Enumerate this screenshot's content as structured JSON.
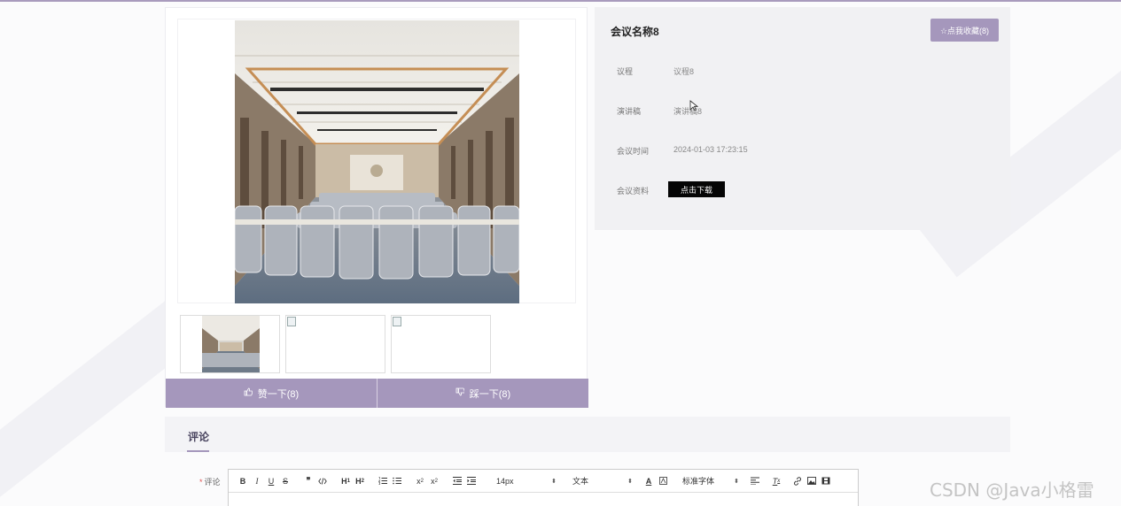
{
  "meeting": {
    "name": "会议名称8",
    "favorite_label": "☆点我收藏(8)",
    "details": [
      {
        "label": "议程",
        "value": "议程8"
      },
      {
        "label": "演讲稿",
        "value": "演讲稿8"
      },
      {
        "label": "会议时间",
        "value": "2024-01-03 17:23:15"
      },
      {
        "label": "会议资料",
        "value": ""
      }
    ],
    "download_label": "点击下载"
  },
  "vote": {
    "like_label": "赞一下(8)",
    "dislike_label": "踩一下(8)"
  },
  "comments": {
    "tab_label": "评论",
    "field_label": "评论",
    "required_mark": "*",
    "toolbar": {
      "size_value": "14px",
      "header_value": "文本",
      "font_value": "标准字体"
    }
  },
  "icons": {
    "favorite": "star-icon",
    "like": "thumbs-up-icon",
    "dislike": "thumbs-down-icon"
  },
  "colors": {
    "accent": "#a597bc",
    "panel_bg": "#f1f1f3",
    "download_bg": "#050505"
  },
  "watermark": "CSDN @Java小格雷"
}
